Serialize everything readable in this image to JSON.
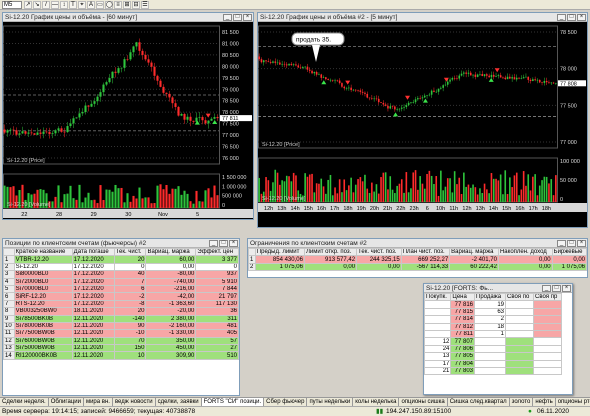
{
  "toolbar": {
    "symbol_select": "M5",
    "buttons": [
      "↗",
      "↘",
      "/",
      "—",
      "↕",
      "T",
      "⌖",
      "A",
      "▭",
      "◯",
      "≡",
      "⊞",
      "⊟",
      "☰"
    ]
  },
  "chart1": {
    "title": "Si-12.20 График цены и объёма - [60 минут]",
    "price_label": "Si-12.20 [Price]",
    "volume_label": "Si-12.20 [Volume]",
    "price_ticks": [
      "81 500",
      "81 000",
      "80 500",
      "80 000",
      "79 500",
      "79 000",
      "78 500",
      "78 000",
      "77 500",
      "77 000",
      "76 500",
      "76 000"
    ],
    "last_price": "77 811",
    "volume_ticks": [
      "1 500 000",
      "1 000 000",
      "500 000",
      "0"
    ],
    "x_ticks": [
      "22",
      "28",
      "29",
      "30",
      "Nov",
      "5"
    ]
  },
  "chart2": {
    "title": "Si-12.20 График цены и объёма #2 - [5 минут]",
    "annotation": "продать 35.",
    "price_label": "Si-12.20 [Price]",
    "volume_label": "Si-12.20 [Volume]",
    "price_ticks": [
      "78 500",
      "78 000",
      "77 500",
      "77 000"
    ],
    "last_price": "77 808",
    "volume_ticks": [
      "100 000",
      "50 000",
      "0"
    ],
    "x_ticks": [
      "12h",
      "13h",
      "14h",
      "15h",
      "16h",
      "17h",
      "18h",
      "19h",
      "20h",
      "21h",
      "22h",
      "23h",
      "6",
      "10h",
      "11h",
      "12h",
      "13h",
      "14h",
      "15h",
      "16h",
      "17h",
      "18h"
    ]
  },
  "positions": {
    "title": "Позиции по клиентским счетам (фьючерсы) #2",
    "columns": [
      "",
      "Краткое название",
      "Дата погаше",
      "Тек. чист.",
      "Вариац. маржа",
      "Эффект. цен"
    ],
    "rows": [
      {
        "n": "1",
        "name": "VTBR-12.20",
        "date": "17.12.2020",
        "qty": "20",
        "var": "60,00",
        "price": "3 377",
        "style": "green"
      },
      {
        "n": "2",
        "name": "Si-12.20",
        "date": "17.12.2020",
        "qty": "0",
        "var": "0,00",
        "price": "0",
        "style": "white"
      },
      {
        "n": "3",
        "name": "Si80000BL0",
        "date": "17.12.2020",
        "qty": "40",
        "var": "-80,00",
        "price": "937",
        "style": "red"
      },
      {
        "n": "4",
        "name": "Si72000BL0",
        "date": "17.12.2020",
        "qty": "7",
        "var": "-740,00",
        "price": "5 910",
        "style": "red"
      },
      {
        "n": "5",
        "name": "Si70000BL0",
        "date": "17.12.2020",
        "qty": "6",
        "var": "-216,00",
        "price": "7 844",
        "style": "red"
      },
      {
        "n": "6",
        "name": "SiRF-12.20",
        "date": "17.12.2020",
        "qty": "-2",
        "var": "-42,00",
        "price": "21 797",
        "style": "red"
      },
      {
        "n": "7",
        "name": "RTS-12.20",
        "date": "17.12.2020",
        "qty": "-8",
        "var": "-1 363,60",
        "price": "117 130",
        "style": "red"
      },
      {
        "n": "8",
        "name": "VB003250BW0",
        "date": "18.11.2020",
        "qty": "20",
        "var": "-20,00",
        "price": "36",
        "style": "red"
      },
      {
        "n": "9",
        "name": "Si78500BK0B",
        "date": "12.11.2020",
        "qty": "-140",
        "var": "2 380,00",
        "price": "311",
        "style": "green"
      },
      {
        "n": "10",
        "name": "Si78000BK0B",
        "date": "12.11.2020",
        "qty": "90",
        "var": "-2 160,00",
        "price": "481",
        "style": "red"
      },
      {
        "n": "11",
        "name": "Si77500BW0B",
        "date": "12.11.2020",
        "qty": "-10",
        "var": "-1 330,00",
        "price": "405",
        "style": "red"
      },
      {
        "n": "12",
        "name": "Si76000BW0B",
        "date": "12.11.2020",
        "qty": "70",
        "var": "350,00",
        "price": "57",
        "style": "green"
      },
      {
        "n": "13",
        "name": "Si75000BW0B",
        "date": "12.11.2020",
        "qty": "150",
        "var": "450,00",
        "price": "27",
        "style": "green"
      },
      {
        "n": "14",
        "name": "RI120000BK0B",
        "date": "12.11.2020",
        "qty": "10",
        "var": "309,90",
        "price": "510",
        "style": "green"
      }
    ]
  },
  "limits": {
    "title": "Ограничения по клиентским счетам #2",
    "columns": [
      "",
      "Предыд. лимит",
      "Лимит откр. поз.",
      "Тек. чист. поз.",
      "План чист. поз.",
      "Вариац. маржа",
      "Накоплен. доход",
      "Биржевые"
    ],
    "rows": [
      {
        "n": "1",
        "prev": "854 430,06",
        "limit": "913 577,42",
        "cur": "244 325,15",
        "plan": "669 252,27",
        "var": "-2 401,70",
        "acc": "0,00",
        "exch": "0,00",
        "style": "pink"
      },
      {
        "n": "2",
        "prev": "1 075,06",
        "limit": "0,00",
        "cur": "0,00",
        "plan": "-567 114,33",
        "var": "60 222,42",
        "acc": "0,00",
        "exch": "1 075,06",
        "style": "green"
      }
    ]
  },
  "quotes": {
    "title": "Si-12.20 [FORTS: Фь...",
    "columns": [
      "Покупк.",
      "Цена",
      "Продажа",
      "Своя по",
      "Своя пр"
    ],
    "rows": [
      {
        "buy": "",
        "price": "77 816",
        "sell": "19"
      },
      {
        "buy": "",
        "price": "77 815",
        "sell": "63"
      },
      {
        "buy": "",
        "price": "77 814",
        "sell": "2"
      },
      {
        "buy": "",
        "price": "77 812",
        "sell": "18"
      },
      {
        "buy": "",
        "price": "77 811",
        "sell": "1"
      },
      {
        "buy": "12",
        "price": "77 807",
        "sell": ""
      },
      {
        "buy": "24",
        "price": "77 806",
        "sell": ""
      },
      {
        "buy": "13",
        "price": "77 805",
        "sell": ""
      },
      {
        "buy": "17",
        "price": "77 804",
        "sell": ""
      },
      {
        "buy": "21",
        "price": "77 803",
        "sell": ""
      }
    ]
  },
  "bottom_tabs": [
    "Сделки неделя.",
    "Облигации",
    "мира вн.",
    "ведж новости",
    "сделки, заявки",
    "FORTS \"СИ\" позици.",
    "Сбер фьючер",
    "путы недельки",
    "колы неделька",
    "опционы сишка",
    "Сишка след.квартал",
    "золото",
    "нефть",
    "опционы ртс",
    "втб"
  ],
  "active_tab": 5,
  "status": {
    "left": "Время сервера: 19:14:15; записей: 9466659; текущая: 40738878",
    "ip": "194.247.150.89:15100",
    "date": "06.11.2020"
  },
  "colors": {
    "green_row": "#9fe07c",
    "red_row": "#f7a6a6",
    "candle_up": "#2ec43c",
    "candle_down": "#ff2b2b",
    "chart_bg": "#000000"
  }
}
